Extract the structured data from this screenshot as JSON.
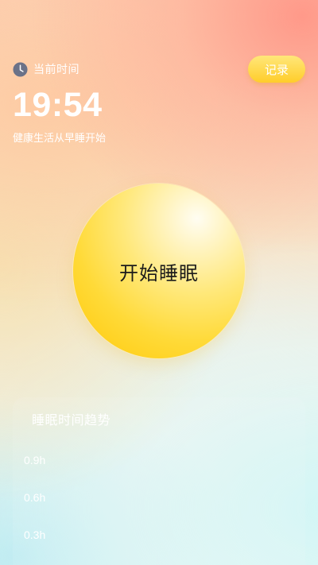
{
  "header": {
    "current_label": "当前时间",
    "record_label": "记录"
  },
  "clock": {
    "time": "19:54",
    "slogan": "健康生活从早睡开始"
  },
  "sleep_button": {
    "label": "开始睡眠"
  },
  "trend": {
    "title": "睡眠时间趋势",
    "y_ticks": [
      "0.9h",
      "0.6h",
      "0.3h"
    ]
  },
  "icons": {
    "clock": "clock-icon"
  },
  "colors": {
    "accent_yellow": "#ffcd2a",
    "text_white": "#ffffff"
  }
}
